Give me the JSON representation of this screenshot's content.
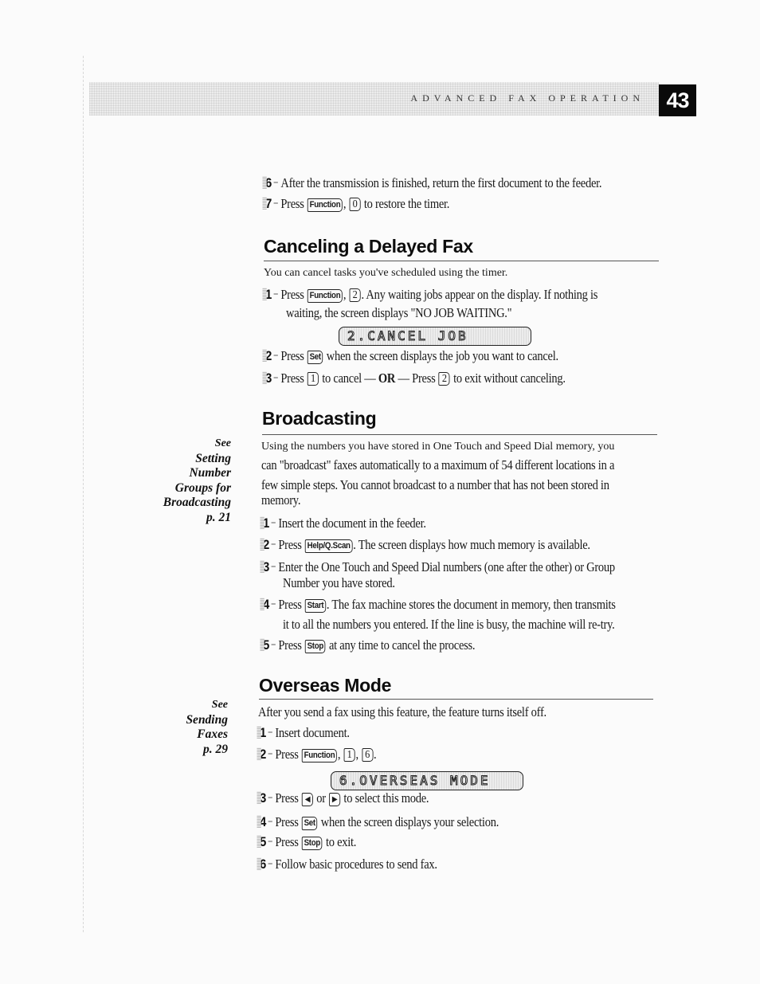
{
  "header": {
    "title": "ADVANCED FAX OPERATION",
    "page_number": "43"
  },
  "top_steps": [
    {
      "num": "6",
      "text": "After the transmission is finished, return the first document to the feeder."
    },
    {
      "num": "7",
      "pre": "Press",
      "keys": [
        "Function",
        "0"
      ],
      "post": "to restore the timer."
    }
  ],
  "canceling": {
    "title": "Canceling a Delayed Fax",
    "intro": "You can cancel tasks you've scheduled using the timer.",
    "step1": {
      "num": "1",
      "pre": "Press",
      "keys": [
        "Function",
        "2"
      ],
      "post": ". Any waiting jobs appear on the display. If nothing is",
      "cont": "waiting, the screen displays \"NO JOB WAITING.\""
    },
    "lcd": "2.CANCEL JOB",
    "step2": {
      "num": "2",
      "pre": "Press",
      "key": "Set",
      "post": "when the screen displays the job you want to cancel."
    },
    "step3": {
      "num": "3",
      "pre": "Press",
      "key1": "1",
      "mid1": "to cancel —",
      "or": "OR",
      "mid2": "— Press",
      "key2": "2",
      "post": "to exit without canceling."
    }
  },
  "broadcasting": {
    "title": "Broadcasting",
    "intro_lines": [
      "Using the numbers you have stored in One Touch and Speed Dial memory, you",
      "can \"broadcast\" faxes automatically to a maximum of 54 different locations in a",
      "few simple steps.  You cannot broadcast to a number that has not been stored in",
      "memory."
    ],
    "sidebar": [
      "See",
      "Setting",
      "Number",
      "Groups for",
      "Broadcasting",
      "p. 21"
    ],
    "step1": {
      "num": "1",
      "text": "Insert the document in the feeder."
    },
    "step2": {
      "num": "2",
      "pre": "Press",
      "key": "Help/Q.Scan",
      "post": ".  The screen displays how much memory is available."
    },
    "step3": {
      "num": "3",
      "text": "Enter the One Touch and Speed Dial numbers (one after the other) or Group",
      "cont": "Number you have stored."
    },
    "step4": {
      "num": "4",
      "pre": "Press",
      "key": "Start",
      "post": ".  The fax machine stores the document in memory, then transmits",
      "cont": "it to all the numbers you entered.  If the line is busy, the machine will re-try."
    },
    "step5": {
      "num": "5",
      "pre": "Press",
      "key": "Stop",
      "post": "at any time to cancel the process."
    }
  },
  "overseas": {
    "title": "Overseas Mode",
    "intro": "After you send a fax using this feature, the feature turns itself off.",
    "sidebar": [
      "See",
      "Sending",
      "Faxes",
      "p. 29"
    ],
    "step1": {
      "num": "1",
      "text": "Insert document."
    },
    "step2": {
      "num": "2",
      "pre": "Press",
      "keys": [
        "Function",
        "1",
        "6"
      ],
      "post": "."
    },
    "lcd": "6.OVERSEAS MODE",
    "step3": {
      "num": "3",
      "pre": "Press",
      "key1": "◀",
      "mid": "or",
      "key2": "▶",
      "post": "to select this mode."
    },
    "step4": {
      "num": "4",
      "pre": "Press",
      "key": "Set",
      "post": "when the screen displays your selection."
    },
    "step5": {
      "num": "5",
      "pre": "Press",
      "key": "Stop",
      "post": "to exit."
    },
    "step6": {
      "num": "6",
      "text": "Follow basic procedures to send fax."
    }
  }
}
